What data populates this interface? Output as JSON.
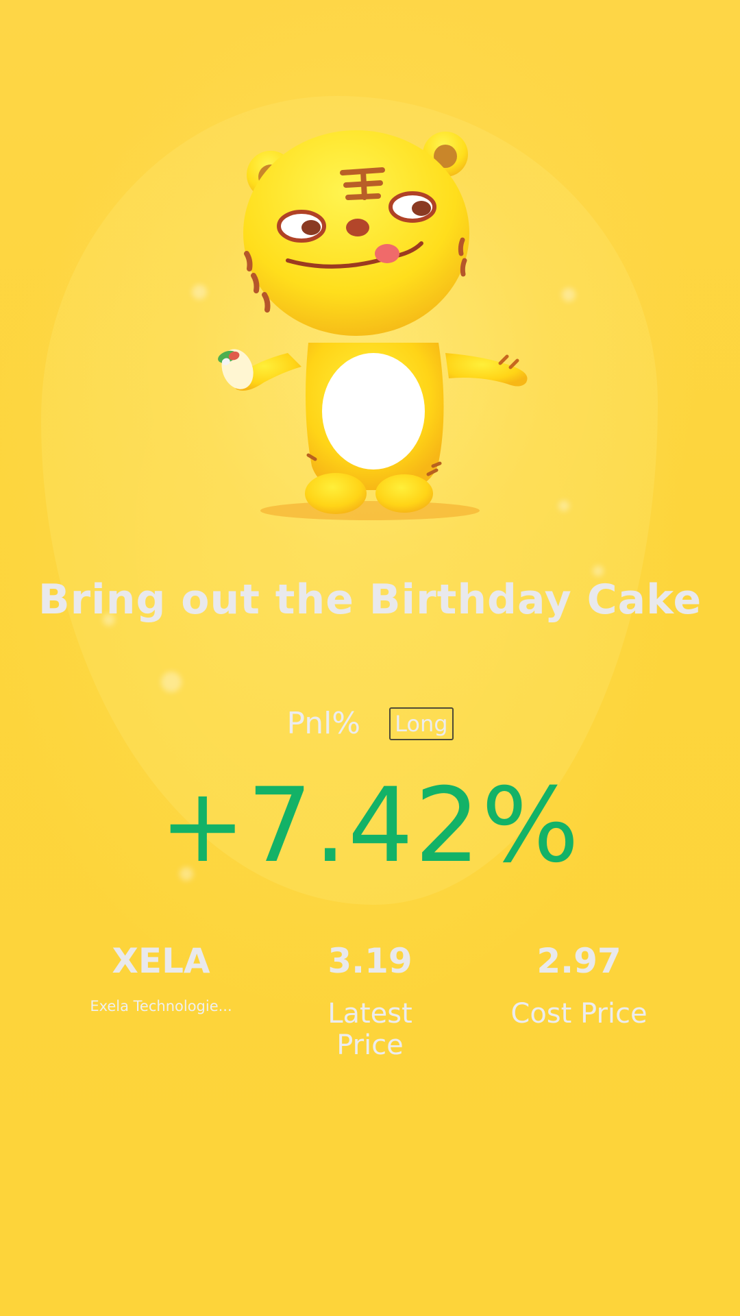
{
  "title": "Bring out the Birthday Cake",
  "pnl": {
    "label": "Pnl%",
    "direction": "Long",
    "value": "+7.42%"
  },
  "stock": {
    "symbol": "XELA",
    "name": "Exela Technologie..."
  },
  "latest": {
    "value": "3.19",
    "label": "Latest Price"
  },
  "cost": {
    "value": "2.97",
    "label": "Cost Price"
  },
  "colors": {
    "background": "#fdd43a",
    "gain": "#13b267",
    "text": "#e9e9ec"
  }
}
